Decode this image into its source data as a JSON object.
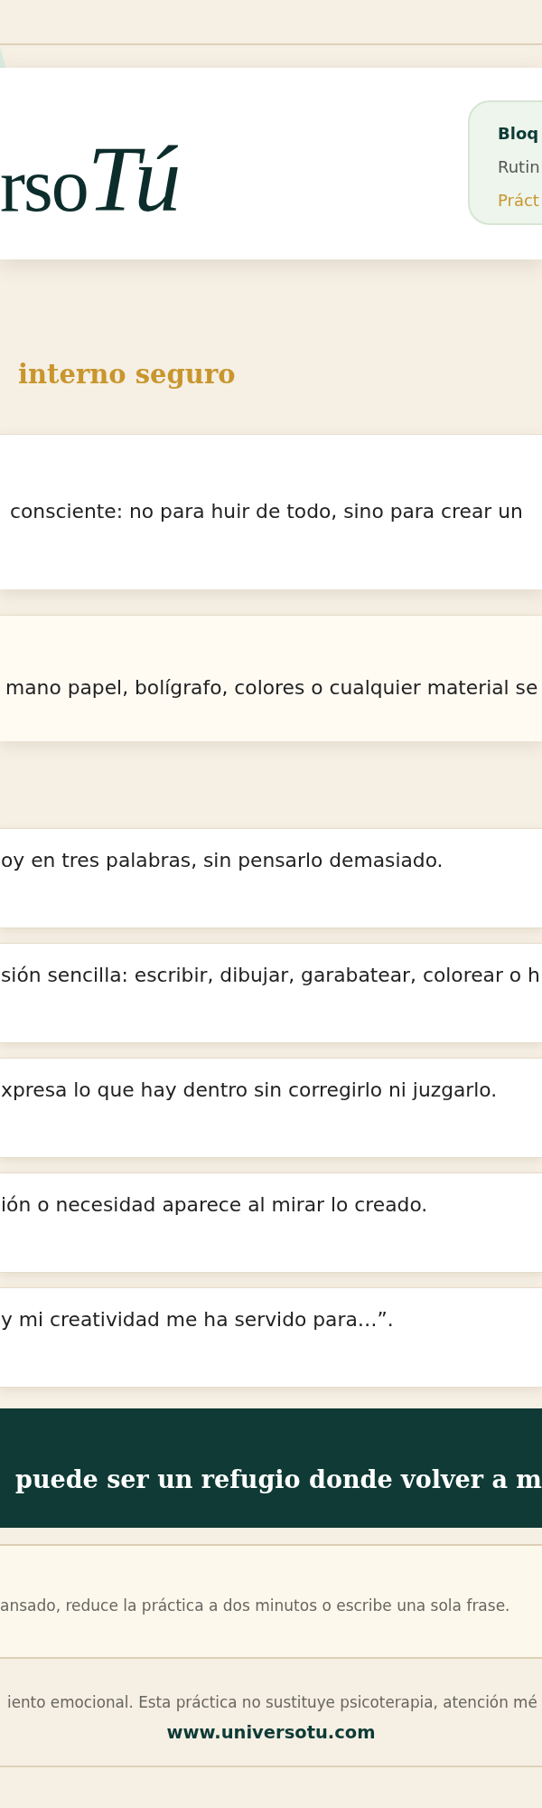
{
  "header": {
    "logo": {
      "text": "rso",
      "script": "Tú"
    },
    "badge": {
      "lines": [
        {
          "kind": "title",
          "text": "Bloq"
        },
        {
          "kind": "subtitle",
          "text": "Rutin"
        },
        {
          "kind": "accent",
          "text": "Práct"
        }
      ]
    }
  },
  "section_title": "interno seguro",
  "intro": {
    "text": "consciente: no para huir de todo, sino para crear un"
  },
  "materials": {
    "text": "mano papel, bolígrafo, colores o cualquier material se"
  },
  "steps": [
    "oy en tres palabras, sin pensarlo demasiado.",
    "sión sencilla: escribir, dibujar, garabatear, colorear o h",
    "xpresa lo que hay dentro sin corregirlo ni juzgarlo.",
    "ión o necesidad aparece al mirar lo creado.",
    "y mi creatividad me ha servido para…”."
  ],
  "banner": {
    "text": "puede ser un refugio donde volver a m"
  },
  "tip": {
    "text": "ansado, reduce la práctica a dos minutos o escribe una sola frase."
  },
  "footer": {
    "disclaimer": "iento emocional. Esta práctica no sustituye psicoterapia, atención mé",
    "url": "www.universotu.com"
  }
}
